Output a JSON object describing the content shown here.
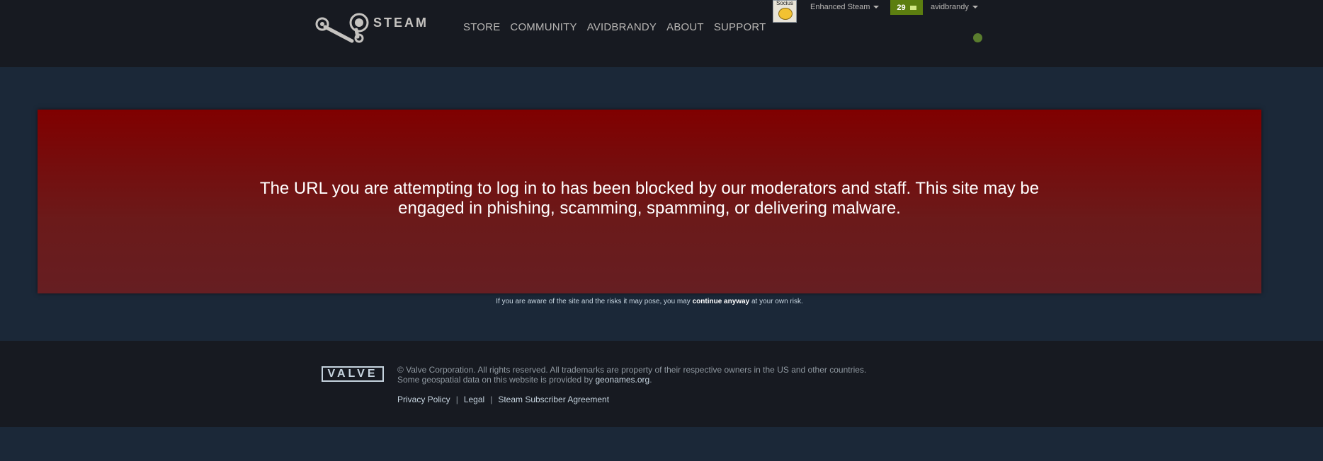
{
  "header": {
    "logo_text": "STEAM",
    "nav": [
      "STORE",
      "COMMUNITY",
      "AVIDBRANDY",
      "ABOUT",
      "SUPPORT"
    ],
    "socius_label": "Socius",
    "extension_menu": "Enhanced Steam",
    "notification_count": "29",
    "account_name": "avidbrandy"
  },
  "error": {
    "message": "The URL you are attempting to log in to has been blocked by our moderators and staff. This site may be engaged in phishing, scamming, spamming, or delivering malware."
  },
  "continue_note": {
    "before": "If you are aware of the site and the risks it may pose, you may ",
    "link": "continue anyway",
    "after": " at your own risk."
  },
  "footer": {
    "valve_logo": "VALVE",
    "copyright_line1": "© Valve Corporation. All rights reserved. All trademarks are property of their respective owners in the US and other countries.",
    "copyright_line2_before": "Some geospatial data on this website is provided by ",
    "copyright_link": "geonames.org",
    "copyright_line2_after": ".",
    "links": [
      "Privacy Policy",
      "Legal",
      "Steam Subscriber Agreement"
    ]
  },
  "colors": {
    "header_bg": "#171a21",
    "page_bg": "#1b2838",
    "error_red": "#800000",
    "notification_green": "#5c7e10"
  }
}
